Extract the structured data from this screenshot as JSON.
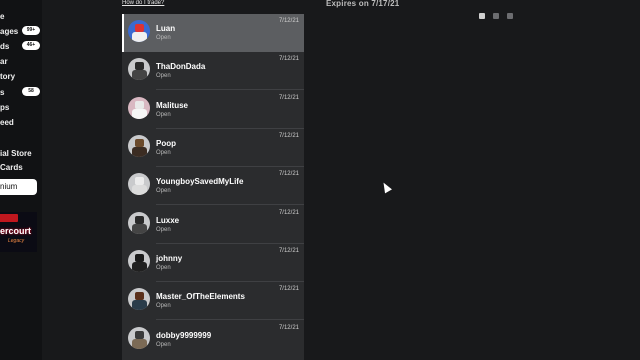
{
  "sidebar": {
    "items": [
      {
        "label": "e"
      },
      {
        "label": "ages",
        "badge": "99+"
      },
      {
        "label": "ds",
        "badge": "46+"
      },
      {
        "label": "ar"
      },
      {
        "label": "tory"
      },
      {
        "label": "s",
        "badge": "58"
      },
      {
        "label": "ps"
      },
      {
        "label": "eed"
      },
      {
        "label": "ial Store"
      },
      {
        "label": "Cards"
      }
    ],
    "premium_label": "nium",
    "promo": {
      "line1": "ercourt",
      "line2": "Legacy"
    }
  },
  "trades": {
    "help_link": "How do I trade?",
    "rows": [
      {
        "name": "Luan",
        "status": "Open",
        "date": "7/12/21"
      },
      {
        "name": "ThaDonDada",
        "status": "Open",
        "date": "7/12/21"
      },
      {
        "name": "Malituse",
        "status": "Open",
        "date": "7/12/21"
      },
      {
        "name": "Poop",
        "status": "Open",
        "date": "7/12/21"
      },
      {
        "name": "YoungboySavedMyLife",
        "status": "Open",
        "date": "7/12/21"
      },
      {
        "name": "Luxxe",
        "status": "Open",
        "date": "7/12/21"
      },
      {
        "name": "johnny",
        "status": "Open",
        "date": "7/12/21"
      },
      {
        "name": "Master_OfTheElements",
        "status": "Open",
        "date": "7/12/21"
      },
      {
        "name": "dobby9999999",
        "status": "Open",
        "date": "7/12/21"
      }
    ]
  },
  "detail": {
    "expires": "Expires on 7/17/21"
  }
}
